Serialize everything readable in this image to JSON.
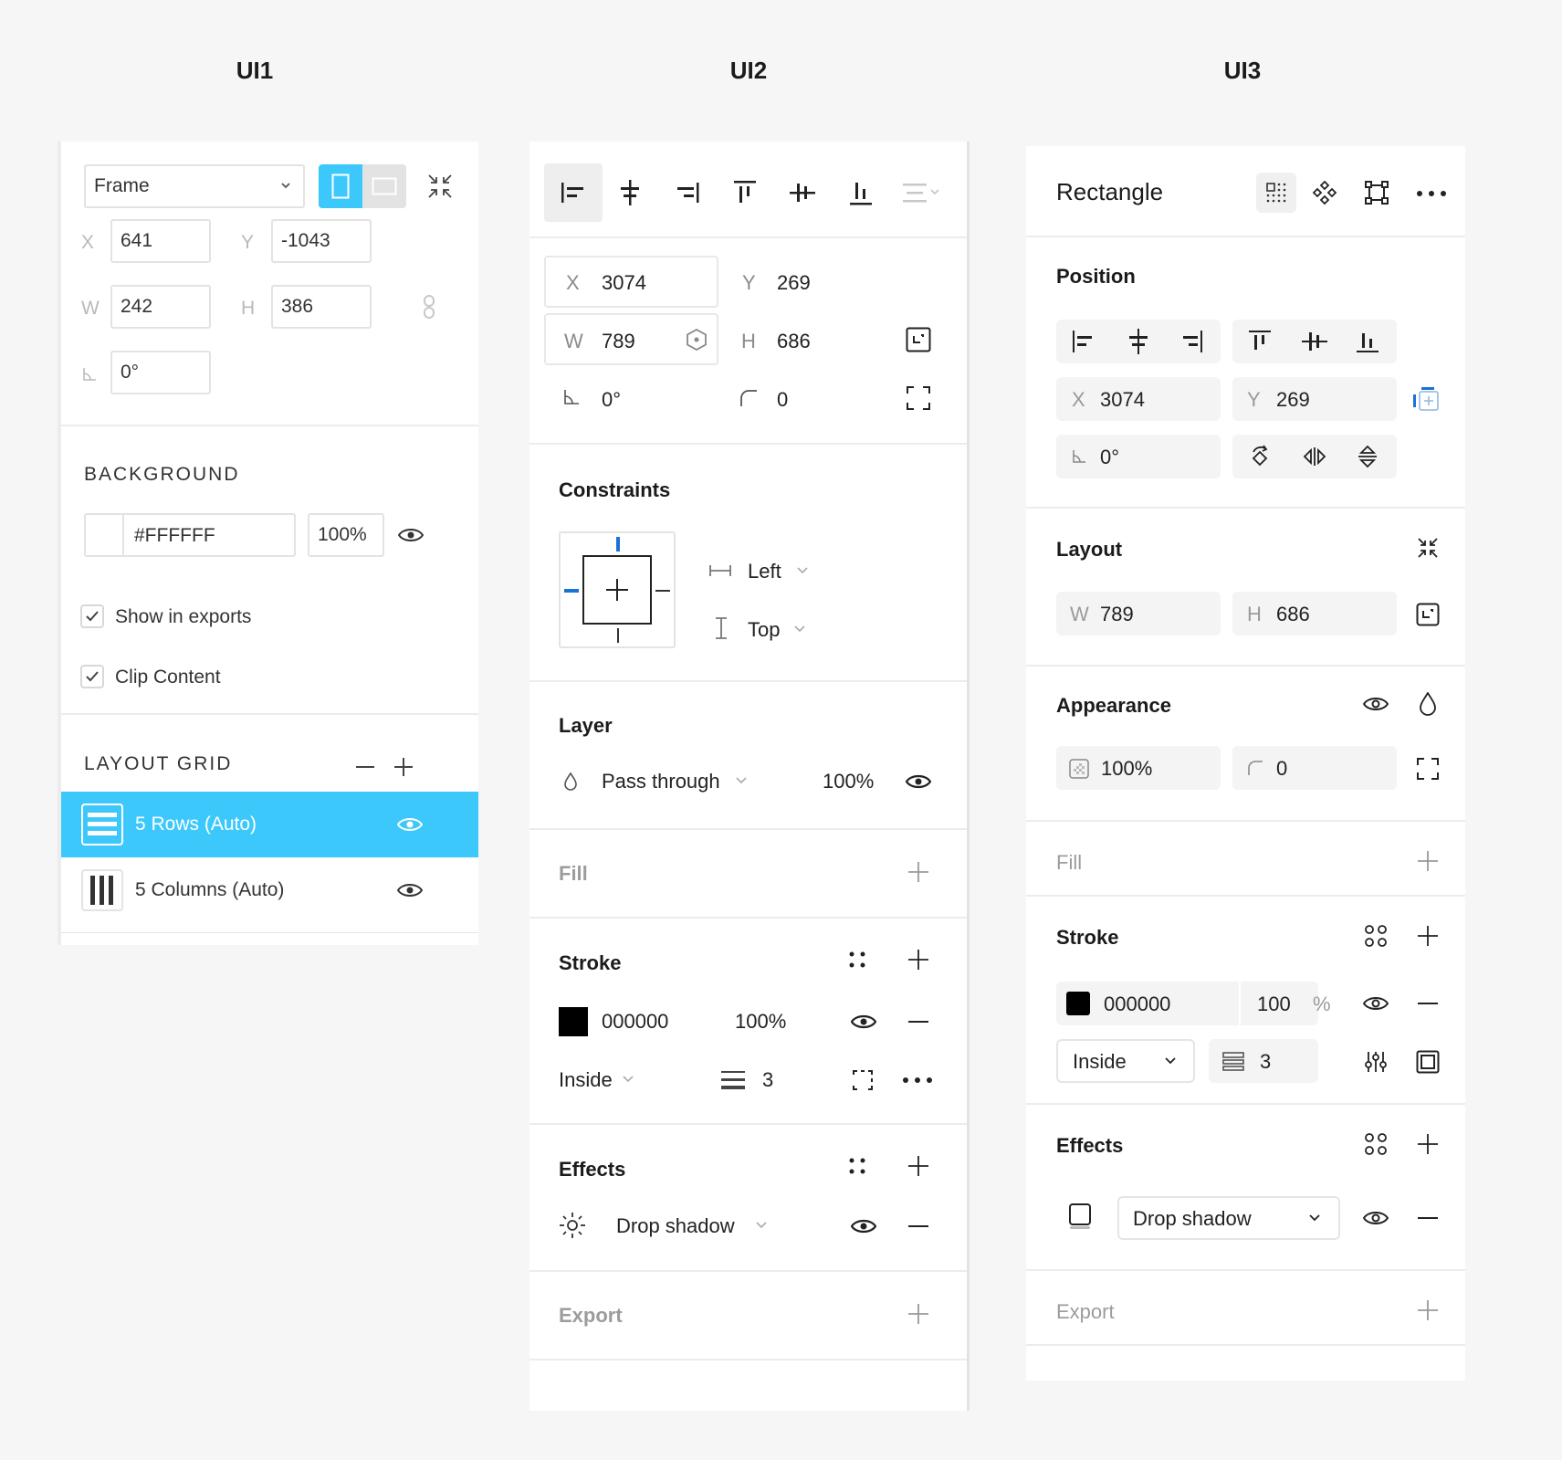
{
  "columns": {
    "ui1": "UI1",
    "ui2": "UI2",
    "ui3": "UI3"
  },
  "ui1": {
    "frame_select": "Frame",
    "x_label": "X",
    "x_value": "641",
    "y_label": "Y",
    "y_value": "-1043",
    "w_label": "W",
    "w_value": "242",
    "h_label": "H",
    "h_value": "386",
    "rotation_value": "0°",
    "background_title": "BACKGROUND",
    "bg_hex": "#FFFFFF",
    "bg_opacity": "100%",
    "show_in_exports": "Show in exports",
    "clip_content": "Clip Content",
    "layout_grid_title": "LAYOUT GRID",
    "grid_items": [
      {
        "label": "5 Rows (Auto)",
        "selected": true
      },
      {
        "label": "5 Columns (Auto)",
        "selected": false
      }
    ],
    "accent": "#3dc8fb"
  },
  "ui2": {
    "x_label": "X",
    "x_value": "3074",
    "y_label": "Y",
    "y_value": "269",
    "w_label": "W",
    "w_value": "789",
    "h_label": "H",
    "h_value": "686",
    "rotation_value": "0°",
    "radius_value": "0",
    "constraints_title": "Constraints",
    "constraint_h": "Left",
    "constraint_v": "Top",
    "layer_title": "Layer",
    "blend_mode": "Pass through",
    "layer_opacity": "100%",
    "fill_title": "Fill",
    "stroke_title": "Stroke",
    "stroke_hex": "000000",
    "stroke_opacity": "100%",
    "stroke_position": "Inside",
    "stroke_weight": "3",
    "effects_title": "Effects",
    "effect_type": "Drop shadow",
    "export_title": "Export",
    "accent": "#1a73d4"
  },
  "ui3": {
    "title": "Rectangle",
    "position_title": "Position",
    "x_label": "X",
    "x_value": "3074",
    "y_label": "Y",
    "y_value": "269",
    "rotation_value": "0°",
    "layout_title": "Layout",
    "w_label": "W",
    "w_value": "789",
    "h_label": "H",
    "h_value": "686",
    "appearance_title": "Appearance",
    "opacity_value": "100%",
    "radius_value": "0",
    "fill_title": "Fill",
    "stroke_title": "Stroke",
    "stroke_hex": "000000",
    "stroke_opacity": "100",
    "stroke_percent": "%",
    "stroke_position": "Inside",
    "stroke_weight": "3",
    "effects_title": "Effects",
    "effect_type": "Drop shadow",
    "export_title": "Export",
    "accent": "#1a73d4"
  }
}
